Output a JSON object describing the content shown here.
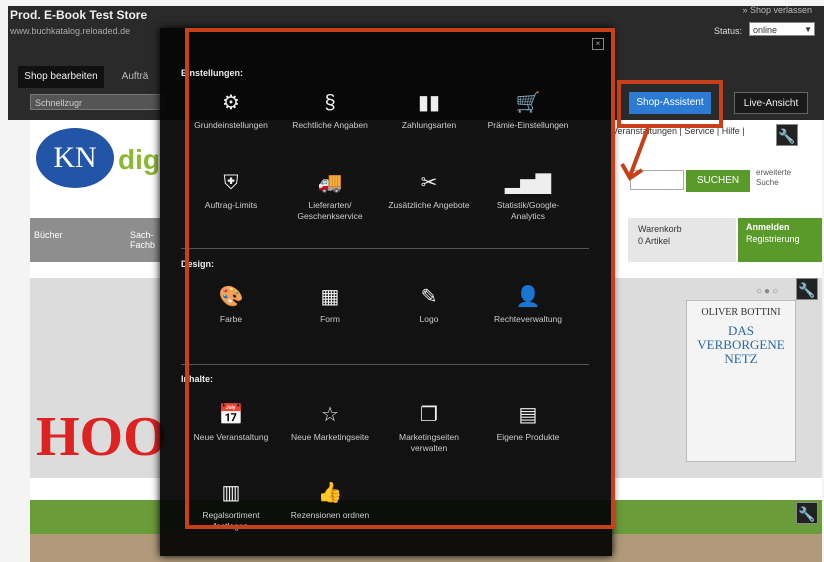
{
  "admin_bar": {
    "store_title": "Prod. E-Book Test Store",
    "store_url": "www.buchkatalog.reloaded.de",
    "leave_shop": "» Shop verlassen",
    "status_label": "Status:",
    "status_value": "online",
    "tabs": [
      {
        "label": "Shop bearbeiten"
      },
      {
        "label": "Aufträ"
      }
    ],
    "quick_input_value": "Schnellzugr",
    "assistant_button": "Shop-Assistent",
    "live_button": "Live-Ansicht"
  },
  "panel": {
    "sections": [
      {
        "title": "Einstellungen:",
        "items": [
          {
            "label": "Grundeinstellungen",
            "icon": "gears-icon"
          },
          {
            "label": "Rechtliche Angaben",
            "icon": "paragraph-icon"
          },
          {
            "label": "Zahlungsarten",
            "icon": "payment-icon"
          },
          {
            "label": "Prämie-Einstellungen",
            "icon": "cart-gear-icon"
          },
          {
            "label": "Auftrag-Limits",
            "icon": "shield-icon"
          },
          {
            "label": "Lieferarten/ Geschenkservice",
            "icon": "truck-icon"
          },
          {
            "label": "Zusätzliche Angebote",
            "icon": "tools-icon"
          },
          {
            "label": "Statistik/Google-Analytics",
            "icon": "bar-chart-icon"
          }
        ]
      },
      {
        "title": "Design:",
        "items": [
          {
            "label": "Farbe",
            "icon": "palette-icon"
          },
          {
            "label": "Form",
            "icon": "layout-icon"
          },
          {
            "label": "Logo",
            "icon": "pen-icon"
          },
          {
            "label": "Rechteverwaltung",
            "icon": "user-gear-icon"
          }
        ]
      },
      {
        "title": "Inhalte:",
        "items": [
          {
            "label": "Neue Veranstaltung",
            "icon": "calendar-add-icon"
          },
          {
            "label": "Neue Marketingseite",
            "icon": "star-icon"
          },
          {
            "label": "Marketingseiten verwalten",
            "icon": "pages-gear-icon"
          },
          {
            "label": "Eigene Produkte",
            "icon": "document-gear-icon"
          },
          {
            "label": "Regalsortiment festlegen",
            "icon": "books-icon"
          },
          {
            "label": "Rezensionen ordnen",
            "icon": "review-icon"
          }
        ]
      }
    ]
  },
  "store": {
    "logo_text": "KN",
    "logo_suffix": "dig",
    "service_links": "Veranstaltungen | Service | Hilfe |",
    "search_button": "SUCHEN",
    "adv_search": "erweiterte Suche",
    "nav_item": "Bücher",
    "nav_item2": "Sach- Fachb",
    "cart_label": "Warenkorb",
    "cart_value": "0 Artikel",
    "login_title": "Anmelden",
    "login_sub": "Registrierung",
    "banner_text": "HOO",
    "book_author": "OLIVER BOTTINI",
    "book_title": "DAS VERBORGENE NETZ"
  },
  "colors": {
    "accent_blue": "#2b7bd4",
    "store_green": "#5a9a2a",
    "annotation_red": "#c8401a"
  }
}
